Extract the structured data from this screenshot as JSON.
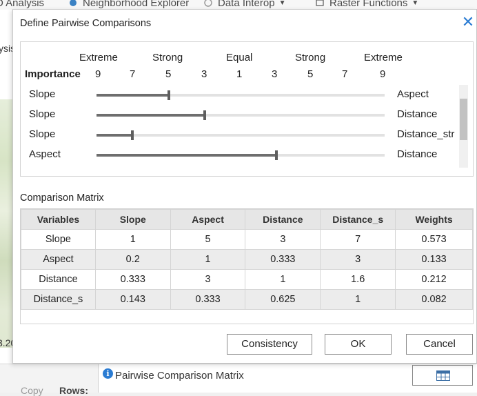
{
  "app": {
    "ribbon": {
      "items": [
        {
          "label": "D Analysis",
          "icon": "analysis-icon"
        },
        {
          "label": "Neighborhood Explorer",
          "icon": "neighborhood-icon"
        },
        {
          "label": "Data Interop",
          "icon": "data-interop-icon"
        },
        {
          "label": "Raster Functions",
          "icon": "raster-functions-icon"
        }
      ]
    },
    "left_pane": {
      "text_top": "ysis",
      "text_bottom": "3.20"
    },
    "status": {
      "info_glyph": "i",
      "label": "Pairwise Comparison Matrix",
      "lower_left": "Copy",
      "lower_mid": "Rows:"
    }
  },
  "dialog": {
    "title": "Define Pairwise Comparisons",
    "close_glyph": "✕",
    "scale": {
      "words": [
        "Extreme",
        "Strong",
        "Equal",
        "Strong",
        "Extreme"
      ],
      "importance_label": "Importance",
      "ticks": [
        "9",
        "7",
        "5",
        "3",
        "1",
        "3",
        "5",
        "7",
        "9"
      ]
    },
    "sliders": [
      {
        "left": "Slope",
        "right": "Aspect",
        "position": 0.25
      },
      {
        "left": "Slope",
        "right": "Distance",
        "position": 0.375
      },
      {
        "left": "Slope",
        "right": "Distance_str",
        "position": 0.125
      },
      {
        "left": "Aspect",
        "right": "Distance",
        "position": 0.625
      }
    ],
    "matrix": {
      "title": "Comparison Matrix",
      "headers": [
        "Variables",
        "Slope",
        "Aspect",
        "Distance",
        "Distance_s",
        "Weights"
      ],
      "rows": [
        [
          "Slope",
          "1",
          "5",
          "3",
          "7",
          "0.573"
        ],
        [
          "Aspect",
          "0.2",
          "1",
          "0.333",
          "3",
          "0.133"
        ],
        [
          "Distance",
          "0.333",
          "3",
          "1",
          "1.6",
          "0.212"
        ],
        [
          "Distance_s",
          "0.143",
          "0.333",
          "0.625",
          "1",
          "0.082"
        ]
      ]
    },
    "buttons": {
      "consistency": "Consistency",
      "ok": "OK",
      "cancel": "Cancel"
    }
  },
  "colors": {
    "accent": "#2b7cd3",
    "slider_fill": "#6e6e6e",
    "header_bg": "#e6e6e6"
  }
}
